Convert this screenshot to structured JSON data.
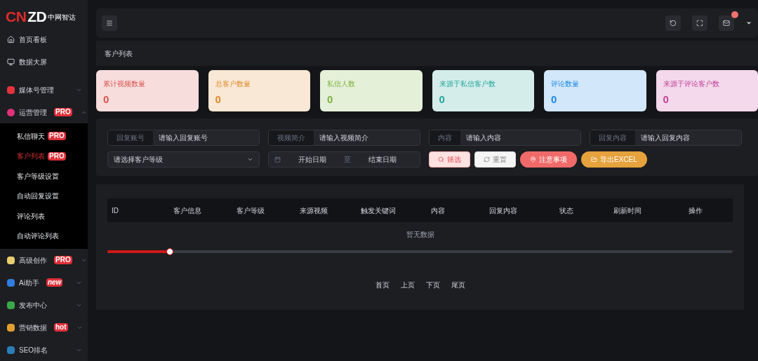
{
  "logo": {
    "mark": "CNZD",
    "name": "中网智达"
  },
  "sidebar": {
    "items": [
      {
        "label": "首页看板"
      },
      {
        "label": "数据大屏"
      },
      {
        "label": "媒体号管理",
        "color": "#e5323e",
        "expanded": false
      },
      {
        "label": "运营管理",
        "color": "#e0307a",
        "badge": "PRO",
        "expanded": true,
        "children": [
          {
            "label": "私信聊天",
            "badge": "PRO",
            "selected": false
          },
          {
            "label": "客户列表",
            "badge": "PRO",
            "selected": true
          },
          {
            "label": "客户等级设置",
            "selected": false
          },
          {
            "label": "自动回复设置",
            "selected": false
          },
          {
            "label": "评论列表",
            "selected": false
          },
          {
            "label": "自动评论列表",
            "selected": false
          }
        ]
      },
      {
        "label": "高级创作",
        "color": "#e8d070",
        "badge": "PRO",
        "expanded": false
      },
      {
        "label": "Ai助手",
        "color": "#2f7de1",
        "badge": "new",
        "expanded": false
      },
      {
        "label": "发布中心",
        "color": "#3aa84a",
        "expanded": false
      },
      {
        "label": "营销数据",
        "color": "#e0a030",
        "badge": "hot",
        "expanded": false
      },
      {
        "label": "SEO排名",
        "color": "#2a7fb8",
        "expanded": false
      }
    ]
  },
  "page_tab": "客户列表",
  "stats": [
    {
      "label": "累计视频数量",
      "value": "0",
      "color": "#d9534f"
    },
    {
      "label": "总客户数量",
      "value": "0",
      "color": "#e08a2c"
    },
    {
      "label": "私信人数",
      "value": "0",
      "color": "#7cb342"
    },
    {
      "label": "来源于私信客户数",
      "value": "0",
      "color": "#26a69a"
    },
    {
      "label": "评论数量",
      "value": "0",
      "color": "#1e88e5"
    },
    {
      "label": "来源于评论客户数",
      "value": "0",
      "color": "#c2409a"
    }
  ],
  "filters": [
    {
      "label": "回复账号",
      "placeholder": "请输入回复账号"
    },
    {
      "label": "视频简介",
      "placeholder": "请输入视频简介"
    },
    {
      "label": "内容",
      "placeholder": "请输入内容"
    },
    {
      "label": "回复内容",
      "placeholder": "请输入回复内容"
    }
  ],
  "level_select": {
    "placeholder": "请选择客户等级"
  },
  "date_range": {
    "start": "开始日期",
    "separator": "至",
    "end": "结束日期"
  },
  "buttons": [
    {
      "label": "筛选",
      "kind": "search"
    },
    {
      "label": "重置",
      "kind": "reset"
    },
    {
      "label": "注意事项",
      "kind": "notice"
    },
    {
      "label": "导出EXCEL",
      "kind": "export"
    }
  ],
  "table": {
    "columns": [
      "ID",
      "客户信息",
      "客户等级",
      "来源视频",
      "触发关键词",
      "内容",
      "回复内容",
      "状态",
      "刷新时间",
      "操作"
    ],
    "empty": "暂无数据"
  },
  "scrollbar": {
    "level": 0.1
  },
  "pagination": [
    "首页",
    "上页",
    "下页",
    "尾页"
  ]
}
